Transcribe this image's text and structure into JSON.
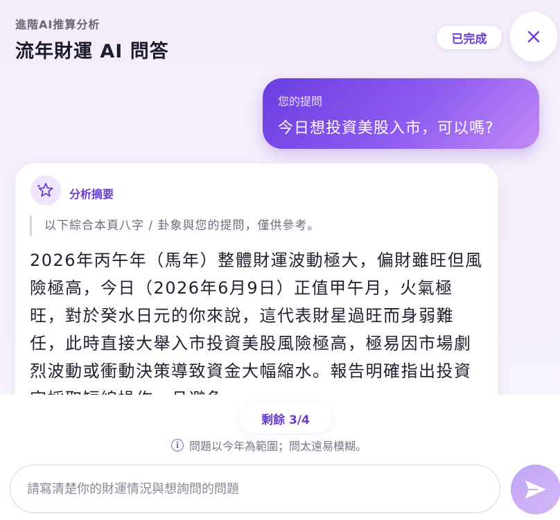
{
  "header": {
    "subtitle": "進階AI推算分析",
    "title": "流年財運 AI 問答",
    "status": "已完成"
  },
  "question": {
    "label": "您的提問",
    "text": "今日想投資美股入市，可以嗎?"
  },
  "answer": {
    "summary_label": "分析摘要",
    "note": "以下綜合本頁八字 / 卦象與您的提問，僅供參考。",
    "text": "2026年丙午年（馬年）整體財運波動極大，偏財雖旺但風險極高，今日（2026年6月9日）正值甲午月，火氣極旺，對於癸水日元的你來說，這代表財星過旺而身弱難任，此時直接大舉入市投資美股風險極高，極易因市場劇烈波動或衝動決策導致資金大幅縮水。報告明確指出投資宜採取短線操作，且避免"
  },
  "footer": {
    "remaining": "剩餘 3/4",
    "hint": "問題以今年為範圍；問太遠易模糊。",
    "input_placeholder": "請寫清楚你的財運情況與想詢問的問題"
  },
  "icons": {
    "close": "close-icon",
    "ai": "sparkle-star-icon",
    "info": "info-icon",
    "send": "send-icon"
  },
  "colors": {
    "accent": "#6a3dd0",
    "bubble_start": "#6a3de0",
    "bubble_end": "#c28af6",
    "send": "#c9aef5"
  }
}
